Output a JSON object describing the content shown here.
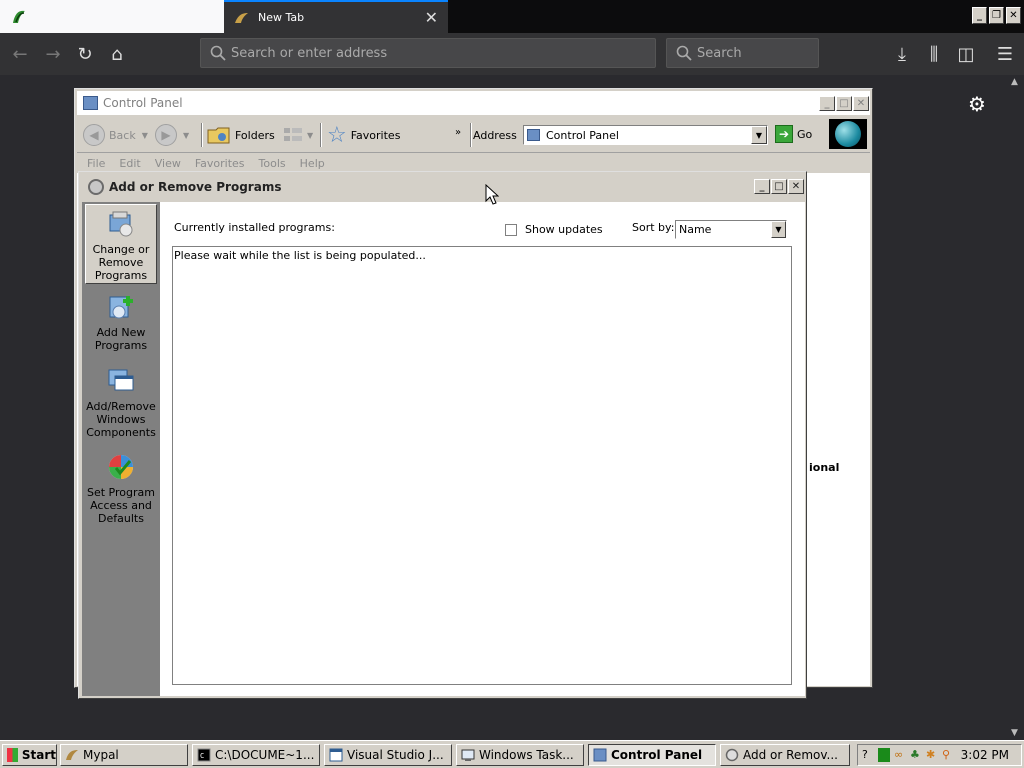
{
  "browser": {
    "tabs": [
      {
        "label": ""
      },
      {
        "label": "New Tab"
      }
    ],
    "url_placeholder": "Search or enter address",
    "search_placeholder": "Search"
  },
  "control_panel": {
    "title": "Control Panel",
    "toolbar": {
      "back": "Back",
      "folders": "Folders",
      "favorites": "Favorites",
      "address_label": "Address",
      "address_value": "Control Panel",
      "go": "Go"
    },
    "menu": [
      "File",
      "Edit",
      "View",
      "Favorites",
      "Tools",
      "Help"
    ],
    "body_fragment": "ional"
  },
  "add_remove": {
    "title": "Add or Remove Programs",
    "sidebar": [
      {
        "label": "Change or Remove Programs",
        "selected": true
      },
      {
        "label": "Add New Programs"
      },
      {
        "label": "Add/Remove Windows Components"
      },
      {
        "label": "Set Program Access and Defaults"
      }
    ],
    "installed_label": "Currently installed programs:",
    "show_updates": "Show updates",
    "sort_label": "Sort by:",
    "sort_value": "Name",
    "list_message": "Please wait while the list is being populated..."
  },
  "taskbar": {
    "start": "Start",
    "tasks": [
      {
        "label": "Mypal"
      },
      {
        "label": "C:\\DOCUME~1..."
      },
      {
        "label": "Visual Studio J..."
      },
      {
        "label": "Windows Task..."
      },
      {
        "label": "Control Panel",
        "active": true
      },
      {
        "label": "Add or Remov..."
      }
    ],
    "clock": "3:02 PM"
  }
}
